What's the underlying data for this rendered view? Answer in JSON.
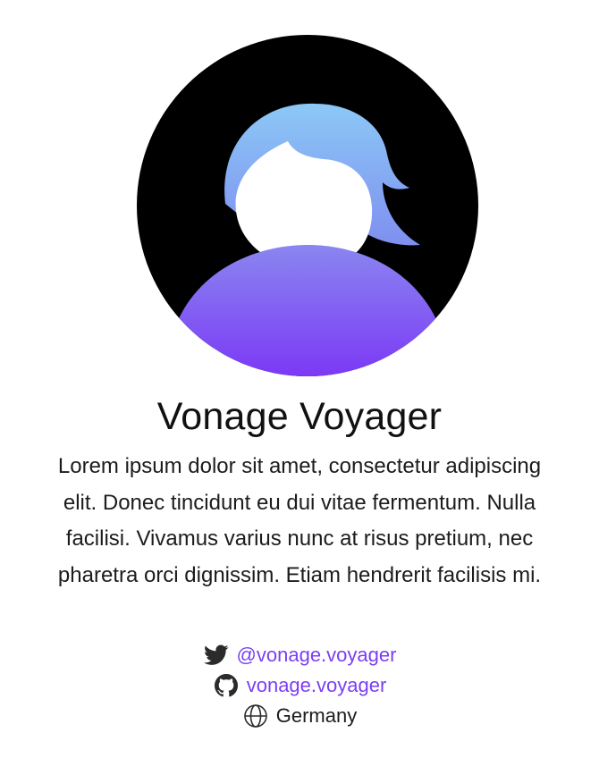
{
  "profile": {
    "name": "Vonage Voyager",
    "bio": "Lorem ipsum dolor sit amet, consectetur adipiscing elit. Donec tincidunt eu dui vitae fermentum. Nulla facilisi. Vivamus varius nunc at risus pretium, nec pharetra orci dignissim. Etiam hendrerit facilisis mi.",
    "avatar_icon": "user-avatar-icon"
  },
  "links": {
    "twitter": {
      "icon": "twitter-icon",
      "label": "@vonage.voyager"
    },
    "github": {
      "icon": "github-icon",
      "label": "vonage.voyager"
    },
    "location": {
      "icon": "globe-icon",
      "label": "Germany"
    }
  },
  "colors": {
    "accent": "#7b3ff2",
    "avatar_background": "#000000",
    "avatar_gradient_top": "#8fc3f6",
    "avatar_gradient_bottom": "#7b2ff7",
    "text": "#1c1c1c"
  }
}
